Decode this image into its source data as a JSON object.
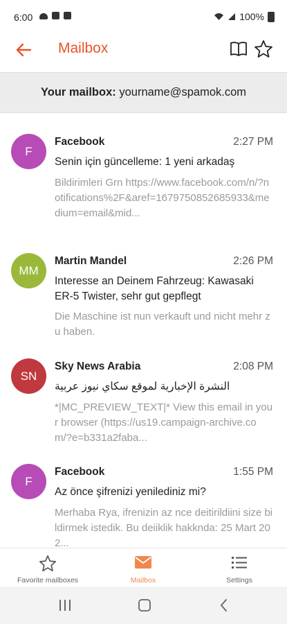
{
  "status": {
    "time": "6:00",
    "battery": "100%"
  },
  "appbar": {
    "title": "Mailbox"
  },
  "mailbox": {
    "label": "Your mailbox:",
    "address": "yourname@spamok.com"
  },
  "emails": [
    {
      "initials": "F",
      "sender": "Facebook",
      "time": "2:27 PM",
      "subject": "Senin için güncelleme: 1 yeni arkadaş",
      "preview": "Bildirimleri Grn https://www.facebook.com/n/?notifications%2F&aref=1679750852685933&medium=email&mid...",
      "color": "#b84cb6"
    },
    {
      "initials": "MM",
      "sender": "Martin Mandel",
      "time": "2:26 PM",
      "subject": "Interesse an Deinem Fahrzeug: Kawasaki ER-5 Twister, sehr gut gepflegt",
      "preview": "Die Maschine ist nun verkauft und nicht mehr zu haben.",
      "color": "#9ab93a"
    },
    {
      "initials": "SN",
      "sender": "Sky News Arabia",
      "time": "2:08 PM",
      "subject": "النشرة الإخبارية لموقع سكاي نيوز عربية",
      "preview": "*|MC_PREVIEW_TEXT|* View this email in your browser (https://us19.campaign-archive.com/?e=b331a2faba...",
      "color": "#c0393f"
    },
    {
      "initials": "F",
      "sender": "Facebook",
      "time": "1:55 PM",
      "subject": "Az önce şifrenizi yenilediniz mi?",
      "preview": "Merhaba Rya, ifrenizin az nce deitirildiini size bildirmek istedik. Bu deiiklik hakknda: 25 Mart 202...",
      "color": "#b84cb6"
    }
  ],
  "nav": [
    {
      "label": "Favorite mailboxes",
      "icon": "star-outline-icon"
    },
    {
      "label": "Mailbox",
      "icon": "mail-icon"
    },
    {
      "label": "Settings",
      "icon": "list-icon"
    }
  ],
  "colors": {
    "accent": "#e8542a",
    "nav_active": "#f0884c"
  }
}
